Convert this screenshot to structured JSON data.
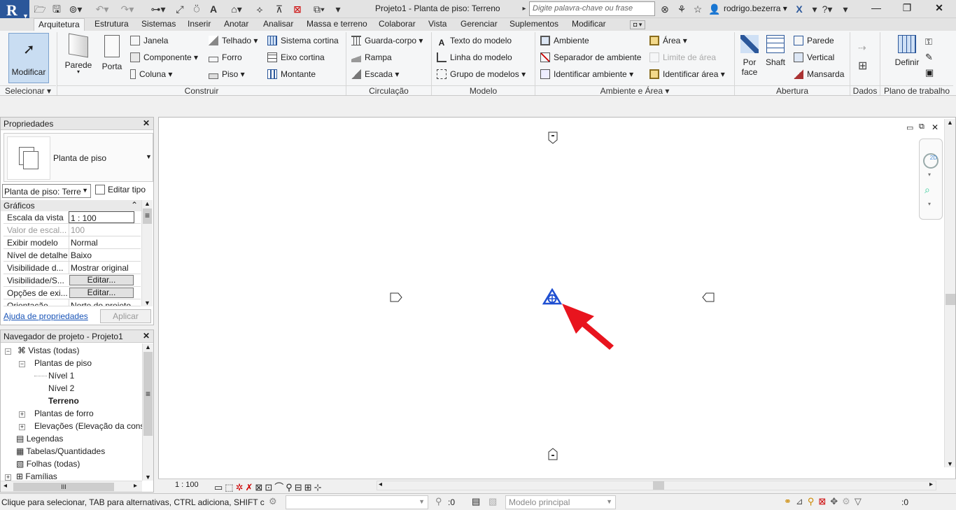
{
  "app": {
    "logo_letter": "R",
    "title": "Projeto1 - Planta de piso: Terreno",
    "search_placeholder": "Digite palavra-chave ou frase",
    "user": "rodrigo.bezerra"
  },
  "tabs": [
    "Arquitetura",
    "Estrutura",
    "Sistemas",
    "Inserir",
    "Anotar",
    "Analisar",
    "Massa e terreno",
    "Colaborar",
    "Vista",
    "Gerenciar",
    "Suplementos",
    "Modificar"
  ],
  "ribbon": {
    "selecionar": {
      "modify": "Modificar",
      "title": "Selecionar"
    },
    "construir": {
      "parede": "Parede",
      "porta": "Porta",
      "janela": "Janela",
      "componente": "Componente",
      "coluna": "Coluna",
      "telhado": "Telhado",
      "forro": "Forro",
      "piso": "Piso",
      "sistema_cortina": "Sistema  cortina",
      "eixo_cortina": "Eixo  cortina",
      "montante": "Montante",
      "title": "Construir"
    },
    "circulacao": {
      "guarda_corpo": "Guarda-corpo",
      "rampa": "Rampa",
      "escada": "Escada",
      "title": "Circulação"
    },
    "modelo": {
      "texto": "Texto  do  modelo",
      "linha": "Linha  do  modelo",
      "grupo": "Grupo  de  modelos",
      "title": "Modelo"
    },
    "ambiente": {
      "ambiente": "Ambiente",
      "separador": "Separador  de  ambiente",
      "identificar": "Identificar  ambiente",
      "area": "Área",
      "limite": "Limite  de  área",
      "identificar_area": "Identificar  área",
      "title": "Ambiente e Área"
    },
    "abertura": {
      "por_face_1": "Por",
      "por_face_2": "face",
      "shaft": "Shaft",
      "parede": "Parede",
      "vertical": "Vertical",
      "mansarda": "Mansarda",
      "title": "Abertura"
    },
    "dados": {
      "title": "Dados"
    },
    "plano": {
      "definir": "Definir",
      "title": "Plano de trabalho"
    }
  },
  "properties": {
    "header": "Propriedades",
    "type_name": "Planta de piso",
    "instance_select": "Planta de piso: Terre",
    "edit_type": "Editar tipo",
    "group": "Gráficos",
    "rows": [
      {
        "k": "Escala da vista",
        "v": "1 : 100"
      },
      {
        "k": "Valor de escal...",
        "v": "100"
      },
      {
        "k": "Exibir modelo",
        "v": "Normal"
      },
      {
        "k": "Nível de detalhe",
        "v": "Baixo"
      },
      {
        "k": "Visibilidade d...",
        "v": "Mostrar original"
      },
      {
        "k": "Visibilidade/S...",
        "v": "Editar..."
      },
      {
        "k": "Opções de exi...",
        "v": "Editar..."
      },
      {
        "k": "Orientação",
        "v": "Norte do projeto"
      }
    ],
    "help_link": "Ajuda de propriedades",
    "apply": "Aplicar"
  },
  "browser": {
    "header": "Navegador de projeto - Projeto1",
    "nodes": {
      "vistas": "Vistas (todas)",
      "plantas_piso": "Plantas de piso",
      "nivel1": "Nível 1",
      "nivel2": "Nível 2",
      "terreno": "Terreno",
      "plantas_forro": "Plantas de forro",
      "elevacoes": "Elevações (Elevação da constr",
      "legendas": "Legendas",
      "tabelas": "Tabelas/Quantidades",
      "folhas": "Folhas (todas)",
      "familias": "Famílias"
    },
    "scroll_thumb": "III"
  },
  "view_bar": {
    "scale": "1 : 100"
  },
  "status": {
    "message": "Clique para selecionar, TAB para alternativas, CTRL adiciona, SHIFT canc",
    "count1": ":0",
    "model": "Modelo principal",
    "count2": ":0"
  },
  "colors": {
    "accent": "#2b579a",
    "survey_point": "#1f4fd1",
    "arrow": "#e8141e"
  }
}
